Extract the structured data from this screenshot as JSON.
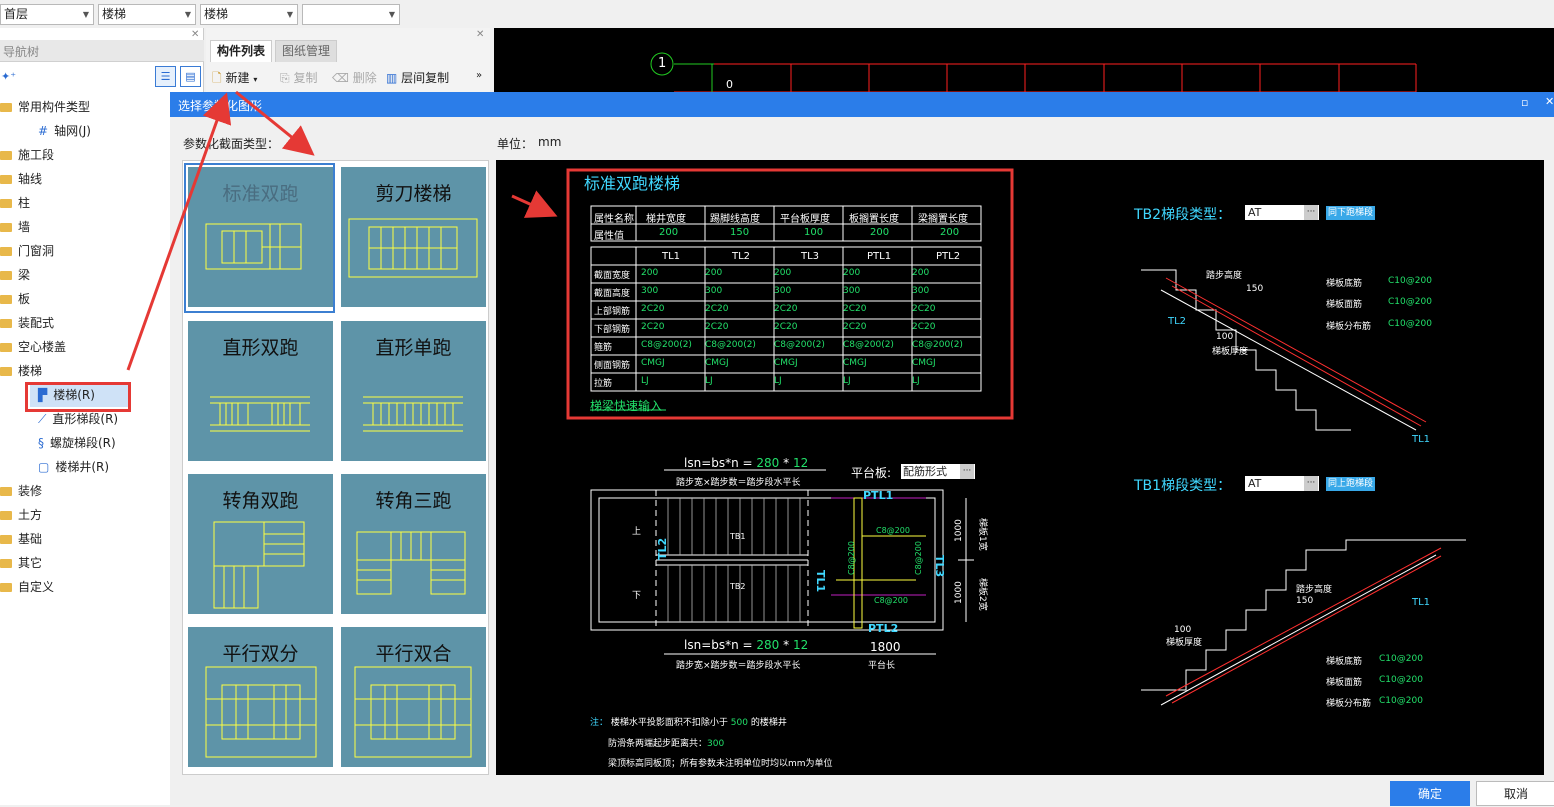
{
  "toolbar": {
    "floor": "首层",
    "category": "楼梯",
    "subcategory": "楼梯",
    "blank": ""
  },
  "nav": {
    "title": "导航树",
    "items": [
      {
        "label": "常用构件类型"
      },
      {
        "label": "轴网(J)"
      },
      {
        "label": "施工段"
      },
      {
        "label": "轴线"
      },
      {
        "label": "柱"
      },
      {
        "label": "墙"
      },
      {
        "label": "门窗洞"
      },
      {
        "label": "梁"
      },
      {
        "label": "板"
      },
      {
        "label": "装配式"
      },
      {
        "label": "空心楼盖"
      },
      {
        "label": "楼梯"
      },
      {
        "label": "楼梯(R)"
      },
      {
        "label": "直形梯段(R)"
      },
      {
        "label": "螺旋梯段(R)"
      },
      {
        "label": "楼梯井(R)"
      },
      {
        "label": "装修"
      },
      {
        "label": "土方"
      },
      {
        "label": "基础"
      },
      {
        "label": "其它"
      },
      {
        "label": "自定义"
      }
    ]
  },
  "component_panel": {
    "tabs": [
      "构件列表",
      "图纸管理"
    ],
    "buttons": [
      "新建",
      "复制",
      "删除",
      "层间复制"
    ]
  },
  "dialog": {
    "title": "选择参数化图形",
    "section_label": "参数化截面类型：",
    "unit_label": "单位：",
    "unit_value": "mm",
    "ok": "确定",
    "cancel": "取消"
  },
  "shapes": [
    "标准双跑",
    "剪刀楼梯",
    "直形双跑",
    "直形单跑",
    "转角双跑",
    "转角三跑",
    "平行双分",
    "平行双合"
  ],
  "preview": {
    "title": "标准双跑楼梯",
    "attr_headers": [
      "属性名称",
      "梯井宽度",
      "踢脚线高度",
      "平台板厚度",
      "板搁置长度",
      "梁搁置长度"
    ],
    "attr_values": [
      "属性值",
      "200",
      "150",
      "100",
      "200",
      "200"
    ],
    "beam_headers": [
      "",
      "TL1",
      "TL2",
      "TL3",
      "PTL1",
      "PTL2"
    ],
    "beam_rows": [
      [
        "截面宽度",
        "200",
        "200",
        "200",
        "200",
        "200"
      ],
      [
        "截面高度",
        "300",
        "300",
        "300",
        "300",
        "300"
      ],
      [
        "上部钢筋",
        "2C20",
        "2C20",
        "2C20",
        "2C20",
        "2C20"
      ],
      [
        "下部钢筋",
        "2C20",
        "2C20",
        "2C20",
        "2C20",
        "2C20"
      ],
      [
        "箍筋",
        "C8@200(2)",
        "C8@200(2)",
        "C8@200(2)",
        "C8@200(2)",
        "C8@200(2)"
      ],
      [
        "侧面钢筋",
        "CMGJ",
        "CMGJ",
        "CMGJ",
        "CMGJ",
        "CMGJ"
      ],
      [
        "拉筋",
        "LJ",
        "LJ",
        "LJ",
        "LJ",
        "LJ"
      ]
    ],
    "quick_input": "梯梁快速输入",
    "tb2_label": "TB2梯段类型：",
    "tb2_value": "AT",
    "tb2_btn": "同下跑梯段",
    "tb1_label": "TB1梯段类型：",
    "tb1_value": "AT",
    "tb1_btn": "同上跑梯段",
    "section_labels": {
      "step_h": "踏步高度",
      "bottom_bar": "梯板底筋",
      "top_bar": "梯板面筋",
      "dist_bar": "梯板分布筋",
      "thick": "梯板厚度",
      "c10": "C10@200",
      "v100": "100",
      "v150": "150",
      "tl1": "TL1",
      "tl2": "TL2"
    },
    "plan": {
      "lsn_top": "lsn=bs*n = ",
      "lsn_a": "280",
      "lsn_b": "12",
      "lsn_sub": "踏步宽×踏步数＝踏步段水平长",
      "platform_label": "平台板:",
      "platform_value": "配筋形式",
      "up": "上",
      "down": "下",
      "tb1": "TB1",
      "tb2": "TB2",
      "ptl1": "PTL1",
      "ptl2": "PTL2",
      "tl1": "TL1",
      "tl2": "TL2",
      "tl3": "TL3",
      "c8": "C8@200",
      "w1": "1000",
      "w2": "1000",
      "seg1": "梯板1宽",
      "seg2": "梯板2宽",
      "plat_len": "1800",
      "plat_len_label": "平台长"
    },
    "notes": {
      "prefix": "注：",
      "n1a": "楼梯水平投影面积不扣除小于 ",
      "n1b": "500",
      "n1c": " 的楼梯井",
      "n2a": "防滑条两端起步距离共：",
      "n2b": "300",
      "n3": "梁顶标高同板顶；所有参数未注明单位时均以mm为单位"
    }
  },
  "cad": {
    "axis_label": "1",
    "axis_num": "0"
  }
}
